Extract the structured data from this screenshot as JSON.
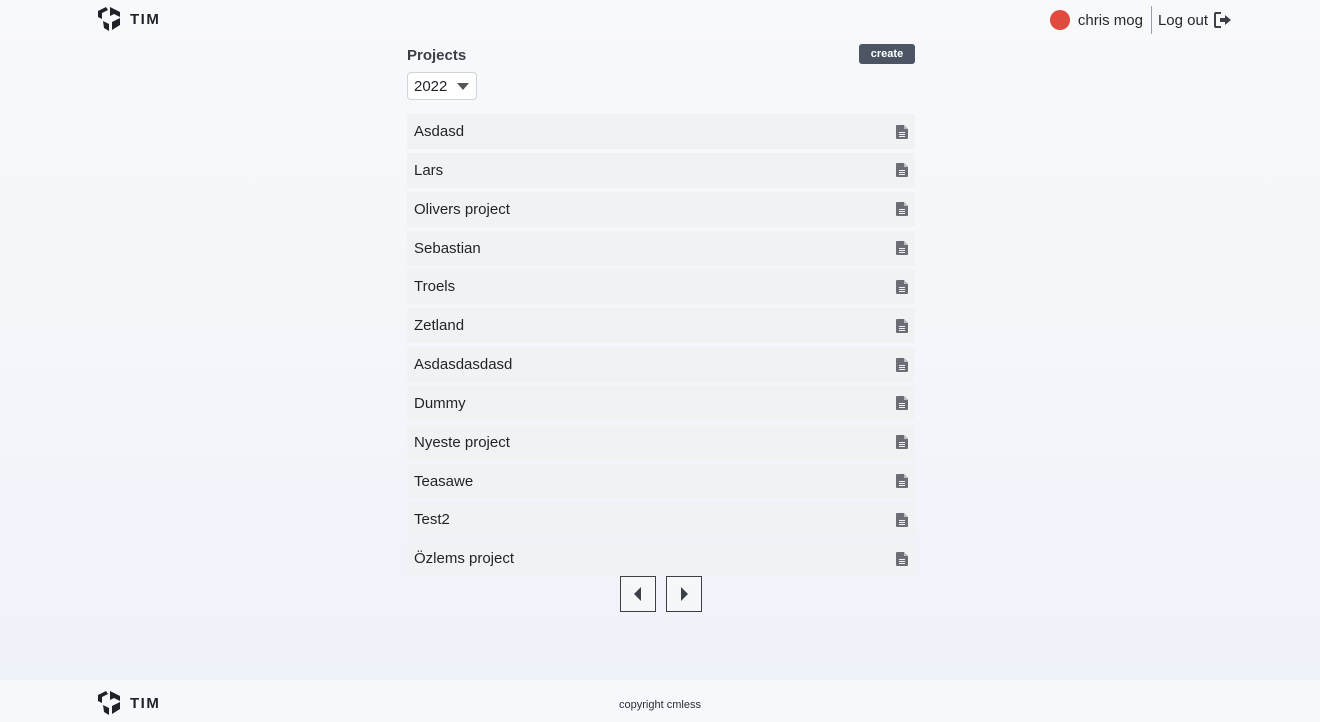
{
  "brand": {
    "name": "TIM"
  },
  "header": {
    "user_name": "chris mog",
    "logout_label": "Log out",
    "avatar_color": "#e04a3f"
  },
  "projects": {
    "title": "Projects",
    "create_label": "create",
    "year_selected": "2022",
    "items": [
      "Asdasd",
      "Lars",
      "Olivers project",
      "Sebastian",
      "Troels",
      "Zetland",
      "Asdasdasdasd",
      "Dummy",
      "Nyeste project",
      "Teasawe",
      "Test2",
      "Özlems project"
    ],
    "item_icon": "document-icon"
  },
  "pagination": {
    "prev_icon": "caret-left-icon",
    "next_icon": "caret-right-icon"
  },
  "footer": {
    "copyright": "copyright cmless"
  }
}
